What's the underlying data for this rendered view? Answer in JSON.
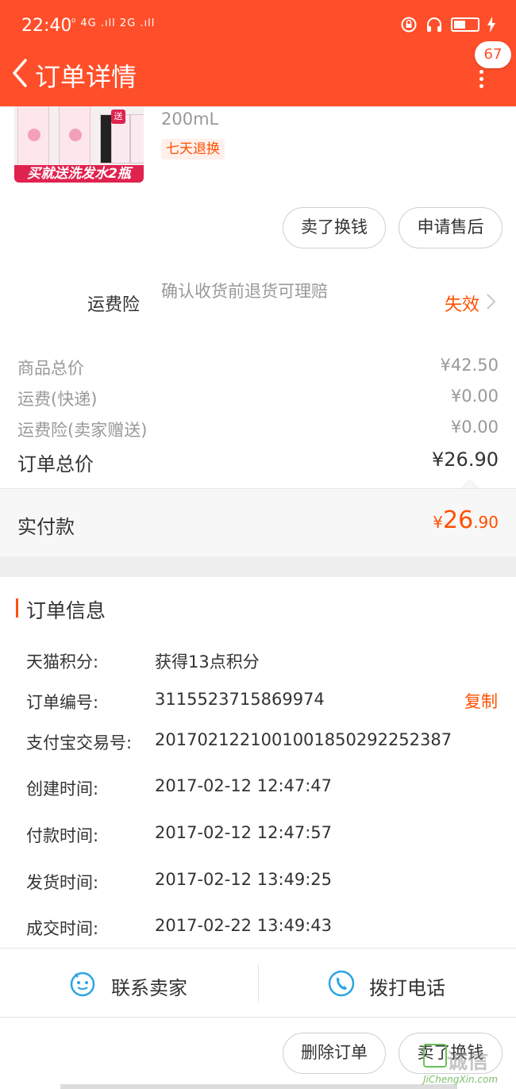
{
  "status_bar": {
    "time": "22:40",
    "network": "⁰ 4G .ıll 2G .ıll"
  },
  "nav": {
    "title": "订单详情",
    "badge": "67"
  },
  "product": {
    "image_promo_text": "买就送洗发水2瓶",
    "image_send_tag": "送",
    "spec": "200mL",
    "service_tag": "七天退换",
    "buttons": {
      "sell_exchange": "卖了换钱",
      "after_sales": "申请售后"
    }
  },
  "insurance": {
    "label": "运费险",
    "desc": "确认收货前退货可理赔",
    "status": "失效"
  },
  "prices": {
    "rows": [
      {
        "label": "商品总价",
        "value": "¥42.50"
      },
      {
        "label": "运费(快递)",
        "value": "¥0.00"
      },
      {
        "label": "运费险(卖家赠送)",
        "value": "¥0.00"
      }
    ],
    "total_label": "订单总价",
    "total_value": "¥26.90",
    "paid_label": "实付款",
    "paid_currency": "¥",
    "paid_int": "26",
    "paid_dec": ".90"
  },
  "order_info": {
    "title": "订单信息",
    "rows": [
      {
        "label": "天猫积分:",
        "value": "获得13点积分"
      },
      {
        "label": "订单编号:",
        "value": "3115523715869974"
      },
      {
        "label": "支付宝交易号:",
        "value": "2017021221001001850292252387"
      },
      {
        "label": "创建时间:",
        "value": "2017-02-12 12:47:47"
      },
      {
        "label": "付款时间:",
        "value": "2017-02-12 12:47:57"
      },
      {
        "label": "发货时间:",
        "value": "2017-02-12 13:49:25"
      },
      {
        "label": "成交时间:",
        "value": "2017-02-22 13:49:43"
      }
    ],
    "copy_label": "复制"
  },
  "contact": {
    "seller": "联系卖家",
    "call": "拨打电话"
  },
  "footer_buttons": {
    "delete_order": "删除订单",
    "sell_exchange": "卖了换钱"
  },
  "watermark": {
    "text": "诚信",
    "sub": "JiChengXin.com"
  },
  "colors": {
    "brand": "#ff4f2a",
    "accent": "#ff5000"
  }
}
